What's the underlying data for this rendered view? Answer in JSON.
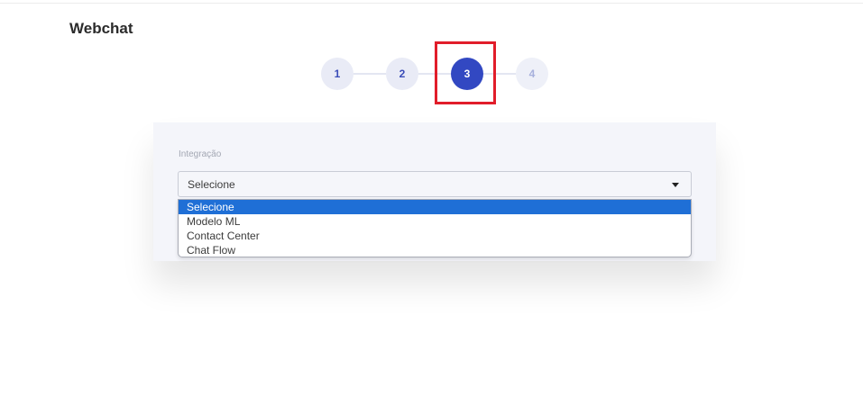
{
  "header": {
    "title": "Webchat"
  },
  "stepper": {
    "steps": [
      {
        "label": "1",
        "state": "done"
      },
      {
        "label": "2",
        "state": "done"
      },
      {
        "label": "3",
        "state": "active"
      },
      {
        "label": "4",
        "state": "upcoming"
      }
    ],
    "highlight_color": "#e11d2a"
  },
  "form": {
    "integration_label": "Integração",
    "integration_select": {
      "value": "Selecione",
      "options": [
        "Selecione",
        "Modelo ML",
        "Contact Center",
        "Chat Flow"
      ],
      "highlighted_option": "Selecione"
    }
  },
  "colors": {
    "primary": "#3248c2",
    "option_highlight": "#1f6fd6",
    "card_background": "#f4f5fa"
  }
}
